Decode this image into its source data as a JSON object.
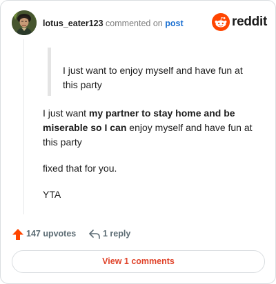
{
  "header": {
    "username": "lotus_eater123",
    "commented_text": "commented on",
    "post_link": "post",
    "brand_word": "reddit",
    "avatar_icon": "portrait-avatar",
    "brand_icon": "reddit-alien-logo-icon"
  },
  "quote": {
    "text": "I just want to enjoy myself and have fun at this party"
  },
  "comment": {
    "p1_start": "I just want ",
    "p1_bold": "my partner to stay home and be miserable so I can",
    "p1_end": " enjoy myself and have fun at this party",
    "p2": "fixed that for you.",
    "p3": "YTA"
  },
  "actions": {
    "upvotes_label": "147 upvotes",
    "reply_label": "1 reply",
    "upvote_icon": "upvote-arrow-icon",
    "reply_icon": "reply-arrow-icon"
  },
  "footer": {
    "view_button_label": "View 1 comments"
  },
  "colors": {
    "accent": "#e0442b",
    "link": "#1a6fd1",
    "muted": "#5c6c74",
    "brand": "#ff4500"
  }
}
